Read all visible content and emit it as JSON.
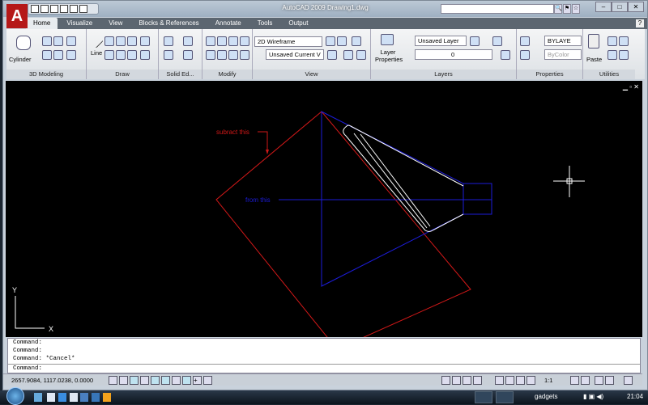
{
  "window": {
    "title": "AutoCAD 2009  Drawing1.dwg",
    "logo": "A"
  },
  "tabs": [
    "Home",
    "Visualize",
    "View",
    "Blocks & References",
    "Annotate",
    "Tools",
    "Output"
  ],
  "ribbon": {
    "panels": [
      "3D Modeling",
      "Draw",
      "Solid Ed...",
      "Modify",
      "View",
      "Layers",
      "Properties",
      "Utilities"
    ],
    "cylinder_label": "Cylinder",
    "line_label": "Line",
    "visual_style": "2D Wireframe",
    "view_dropdown": "Unsaved Current V",
    "layer_properties": "Layer Properties",
    "layer_state": "Unsaved Layer",
    "layer_current": "0",
    "color": "BYLAYE",
    "plot_style": "ByColor",
    "paste_label": "Paste"
  },
  "drawing": {
    "annotation_subtract": "subract this",
    "annotation_from": "from this",
    "ucs_x": "X",
    "ucs_y": "Y",
    "colors": {
      "red": "#d01818",
      "blue": "#1c1cd8",
      "white": "#ffffff",
      "background": "#000000"
    }
  },
  "command": {
    "history": [
      "Command:",
      "Command:",
      "Command: *Cancel*"
    ],
    "prompt": "Command:"
  },
  "status": {
    "coordinates": "2657.9084, 1117.0238, 0.0000",
    "annotation_scale": "1:1"
  },
  "taskbar": {
    "gadgets": "gadgets",
    "clock": "21:04"
  }
}
